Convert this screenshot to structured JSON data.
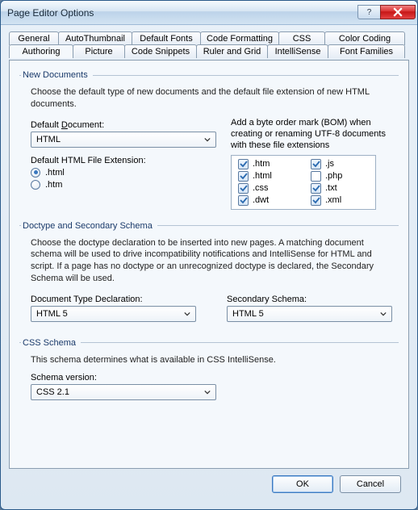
{
  "window": {
    "title": "Page Editor Options"
  },
  "winButtons": {
    "help": "?",
    "close": "Close"
  },
  "tabs": {
    "row1": [
      "General",
      "AutoThumbnail",
      "Default Fonts",
      "Code Formatting",
      "CSS",
      "Color Coding"
    ],
    "row2": [
      "Authoring",
      "Picture",
      "Code Snippets",
      "Ruler and Grid",
      "IntelliSense",
      "Font Families"
    ],
    "active": "Authoring"
  },
  "newDocs": {
    "legend": "New Documents",
    "desc": "Choose the default type of new documents and the default file extension of new HTML documents.",
    "defaultDocLabelPre": "Default ",
    "defaultDocLabelU": "D",
    "defaultDocLabelPost": "ocument:",
    "defaultDocValue": "HTML",
    "extLabel": "Default HTML File Extension:",
    "radios": [
      {
        "label": ".html",
        "checked": true,
        "u": "l"
      },
      {
        "label": ".htm",
        "checked": false,
        "u": "m"
      }
    ],
    "bomDesc": "Add a byte order mark (BOM) when creating or renaming UTF-8 documents with these file extensions",
    "bomChecks": [
      {
        "label": ".htm",
        "checked": true
      },
      {
        "label": ".js",
        "checked": true
      },
      {
        "label": ".html",
        "checked": true
      },
      {
        "label": ".php",
        "checked": false
      },
      {
        "label": ".css",
        "checked": true
      },
      {
        "label": ".txt",
        "checked": true
      },
      {
        "label": ".dwt",
        "checked": true
      },
      {
        "label": ".xml",
        "checked": true
      }
    ]
  },
  "doctype": {
    "legend": "Doctype and Secondary Schema",
    "desc": "Choose the doctype declaration to be inserted into new pages. A matching document schema will be used to drive incompatibility notifications and IntelliSense for HTML and script. If a page has no doctype or an unrecognized doctype is declared, the Secondary Schema will be used.",
    "docTypeLabel": "Document Type Declaration:",
    "docTypeValue": "HTML 5",
    "secondaryLabel": "Secondary Schema:",
    "secondaryValue": "HTML 5"
  },
  "cssSchema": {
    "legend": "CSS Schema",
    "desc": "This schema determines what is available in CSS IntelliSense.",
    "label": "Schema version:",
    "value": "CSS 2.1"
  },
  "buttons": {
    "ok": "OK",
    "cancel": "Cancel"
  }
}
